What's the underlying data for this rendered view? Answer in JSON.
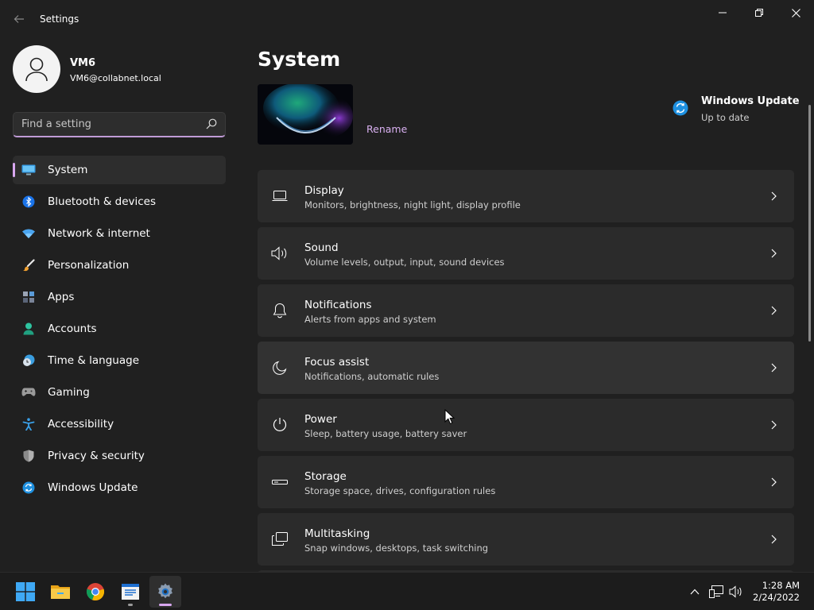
{
  "window": {
    "title": "Settings"
  },
  "user": {
    "name": "VM6",
    "email": "VM6@collabnet.local"
  },
  "search": {
    "placeholder": "Find a setting"
  },
  "sidebar": {
    "items": [
      {
        "label": "System",
        "icon": "monitor-icon",
        "selected": true
      },
      {
        "label": "Bluetooth & devices",
        "icon": "bluetooth-icon"
      },
      {
        "label": "Network & internet",
        "icon": "wifi-icon"
      },
      {
        "label": "Personalization",
        "icon": "paintbrush-icon"
      },
      {
        "label": "Apps",
        "icon": "apps-icon"
      },
      {
        "label": "Accounts",
        "icon": "person-icon"
      },
      {
        "label": "Time & language",
        "icon": "clock-globe-icon"
      },
      {
        "label": "Gaming",
        "icon": "gamepad-icon"
      },
      {
        "label": "Accessibility",
        "icon": "accessibility-icon"
      },
      {
        "label": "Privacy & security",
        "icon": "shield-icon"
      },
      {
        "label": "Windows Update",
        "icon": "update-icon"
      }
    ]
  },
  "main": {
    "title": "System",
    "rename_label": "Rename",
    "windows_update": {
      "title": "Windows Update",
      "status": "Up to date"
    },
    "cards": [
      {
        "title": "Display",
        "desc": "Monitors, brightness, night light, display profile",
        "icon": "display-icon"
      },
      {
        "title": "Sound",
        "desc": "Volume levels, output, input, sound devices",
        "icon": "speaker-icon"
      },
      {
        "title": "Notifications",
        "desc": "Alerts from apps and system",
        "icon": "bell-icon"
      },
      {
        "title": "Focus assist",
        "desc": "Notifications, automatic rules",
        "icon": "moon-icon"
      },
      {
        "title": "Power",
        "desc": "Sleep, battery usage, battery saver",
        "icon": "power-icon"
      },
      {
        "title": "Storage",
        "desc": "Storage space, drives, configuration rules",
        "icon": "storage-icon"
      },
      {
        "title": "Multitasking",
        "desc": "Snap windows, desktops, task switching",
        "icon": "multitasking-icon"
      }
    ]
  },
  "taskbar": {
    "apps": [
      "start-icon",
      "file-explorer-icon",
      "chrome-icon",
      "notepad-icon",
      "settings-icon"
    ],
    "clock": {
      "time": "1:28 AM",
      "date": "2/24/2022"
    }
  },
  "colors": {
    "accent": "#d8a7f0",
    "background": "#202020",
    "card": "#2b2b2b",
    "taskbar": "#1c1c1c"
  }
}
